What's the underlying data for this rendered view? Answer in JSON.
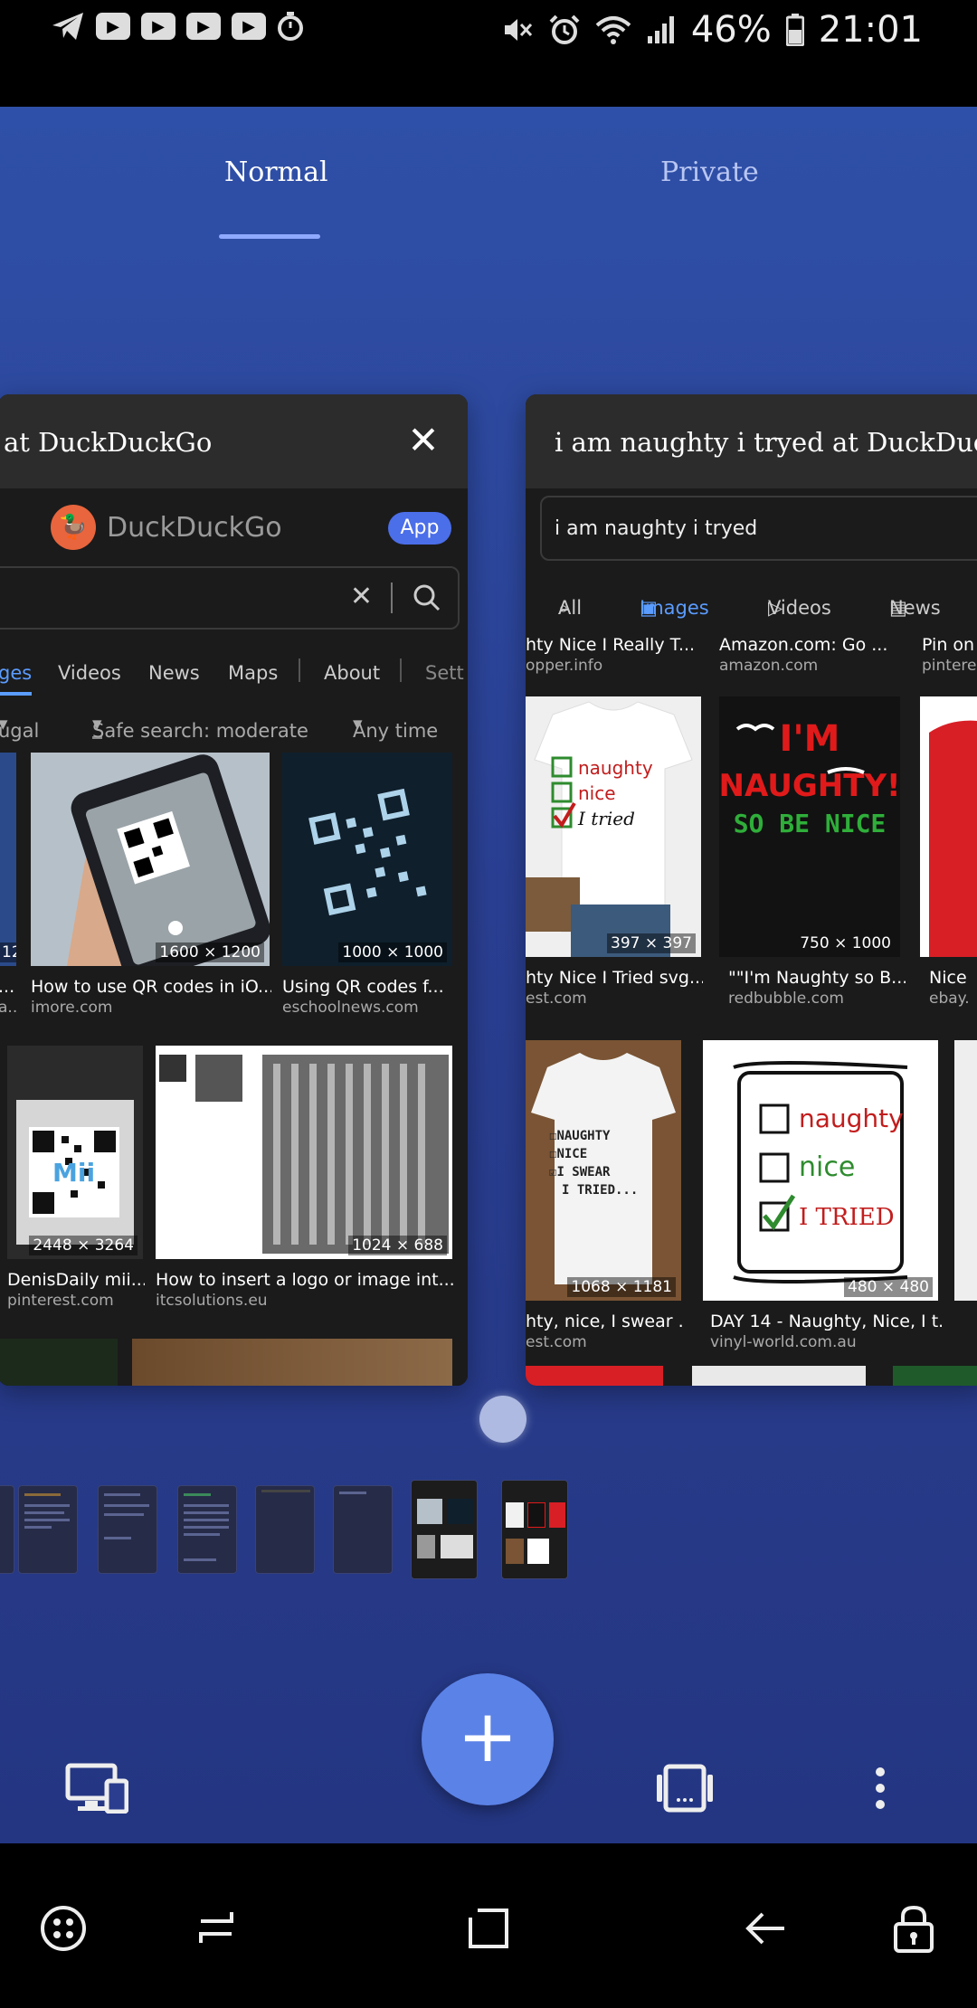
{
  "status_bar": {
    "battery_percent": "46%",
    "time": "21:01",
    "left_icons": [
      "telegram-icon",
      "youtube-icon",
      "youtube-icon",
      "youtube-icon",
      "youtube-icon",
      "stopwatch-icon"
    ],
    "right_icons": [
      "mute-icon",
      "alarm-icon",
      "wifi-icon",
      "signal-icon",
      "battery-icon"
    ]
  },
  "tabs": {
    "normal": "Normal",
    "private": "Private",
    "active": "normal"
  },
  "cards": {
    "left": {
      "title": "at DuckDuckGo",
      "brand": "DuckDuckGo",
      "app_button": "App",
      "nav": {
        "images": "ges",
        "videos": "Videos",
        "news": "News",
        "maps": "Maps",
        "about": "About",
        "settings": "Sett"
      },
      "filters": {
        "region": "ugal",
        "safe_search": "Safe search: moderate",
        "time": "Any time"
      },
      "results": [
        {
          "dims": "1600 × 1200",
          "caption": "How to use QR codes in iO...",
          "source": "imore.com"
        },
        {
          "dims": "1000 × 1000",
          "caption": "Using QR codes f...",
          "source": "eschoolnews.com"
        },
        {
          "dims": "2448 × 3264",
          "caption": "DenisDaily mii...",
          "source": "pinterest.com"
        },
        {
          "dims": "1024 × 688",
          "caption": "How to insert a logo or image int...",
          "source": "itcsolutions.eu"
        }
      ],
      "partial_left": {
        "dims": "12",
        "caption": "...",
        "source": "a..."
      }
    },
    "right": {
      "title": "i am naughty i tryed at DuckDuckGo",
      "query": "i am naughty i tryed",
      "nav": {
        "all": "All",
        "images": "Images",
        "videos": "Videos",
        "news": "News"
      },
      "top_row": [
        {
          "caption": "hty Nice I Really T...",
          "source": "opper.info"
        },
        {
          "caption": "Amazon.com: Go ...",
          "source": "amazon.com"
        },
        {
          "caption": "Pin on",
          "source": "pintere"
        }
      ],
      "row2": [
        {
          "dims": "397 × 397",
          "caption": "hty Nice I Tried svg...",
          "source": "est.com",
          "shirt_text": [
            "naughty",
            "nice",
            "I tried"
          ]
        },
        {
          "dims": "750 × 1000",
          "caption": "\"\"I'm Naughty so B...",
          "source": "redbubble.com",
          "shirt_text": [
            "I'M",
            "NAUGHTY!",
            "SO BE NICE"
          ]
        },
        {
          "caption": "Nice",
          "source": "ebay."
        }
      ],
      "row3": [
        {
          "dims": "1068 × 1181",
          "caption": "hty, nice, I swear ...",
          "source": "est.com",
          "shirt_text": [
            "NAUGHTY",
            "NICE",
            "I SWEAR",
            "I TRIED..."
          ]
        },
        {
          "dims": "480 × 480",
          "caption": "DAY 14 - Naughty, Nice, I t...",
          "source": "vinyl-world.com.au",
          "shirt_text": [
            "naughty",
            "nice",
            "I TRIED"
          ]
        }
      ]
    }
  },
  "bottom_actions": {
    "fab_label": "+",
    "icons": [
      "desktop-mode-icon",
      "tab-overview-icon",
      "more-options-icon"
    ]
  },
  "system_nav": [
    "game-launcher-icon",
    "recents-icon",
    "home-icon",
    "back-icon",
    "lock-icon"
  ],
  "colors": {
    "background_top": "#2f50a8",
    "background_bottom": "#243682",
    "accent": "#5b82e6",
    "ddg_orange": "#e8653d",
    "link_blue": "#5b9cff"
  }
}
